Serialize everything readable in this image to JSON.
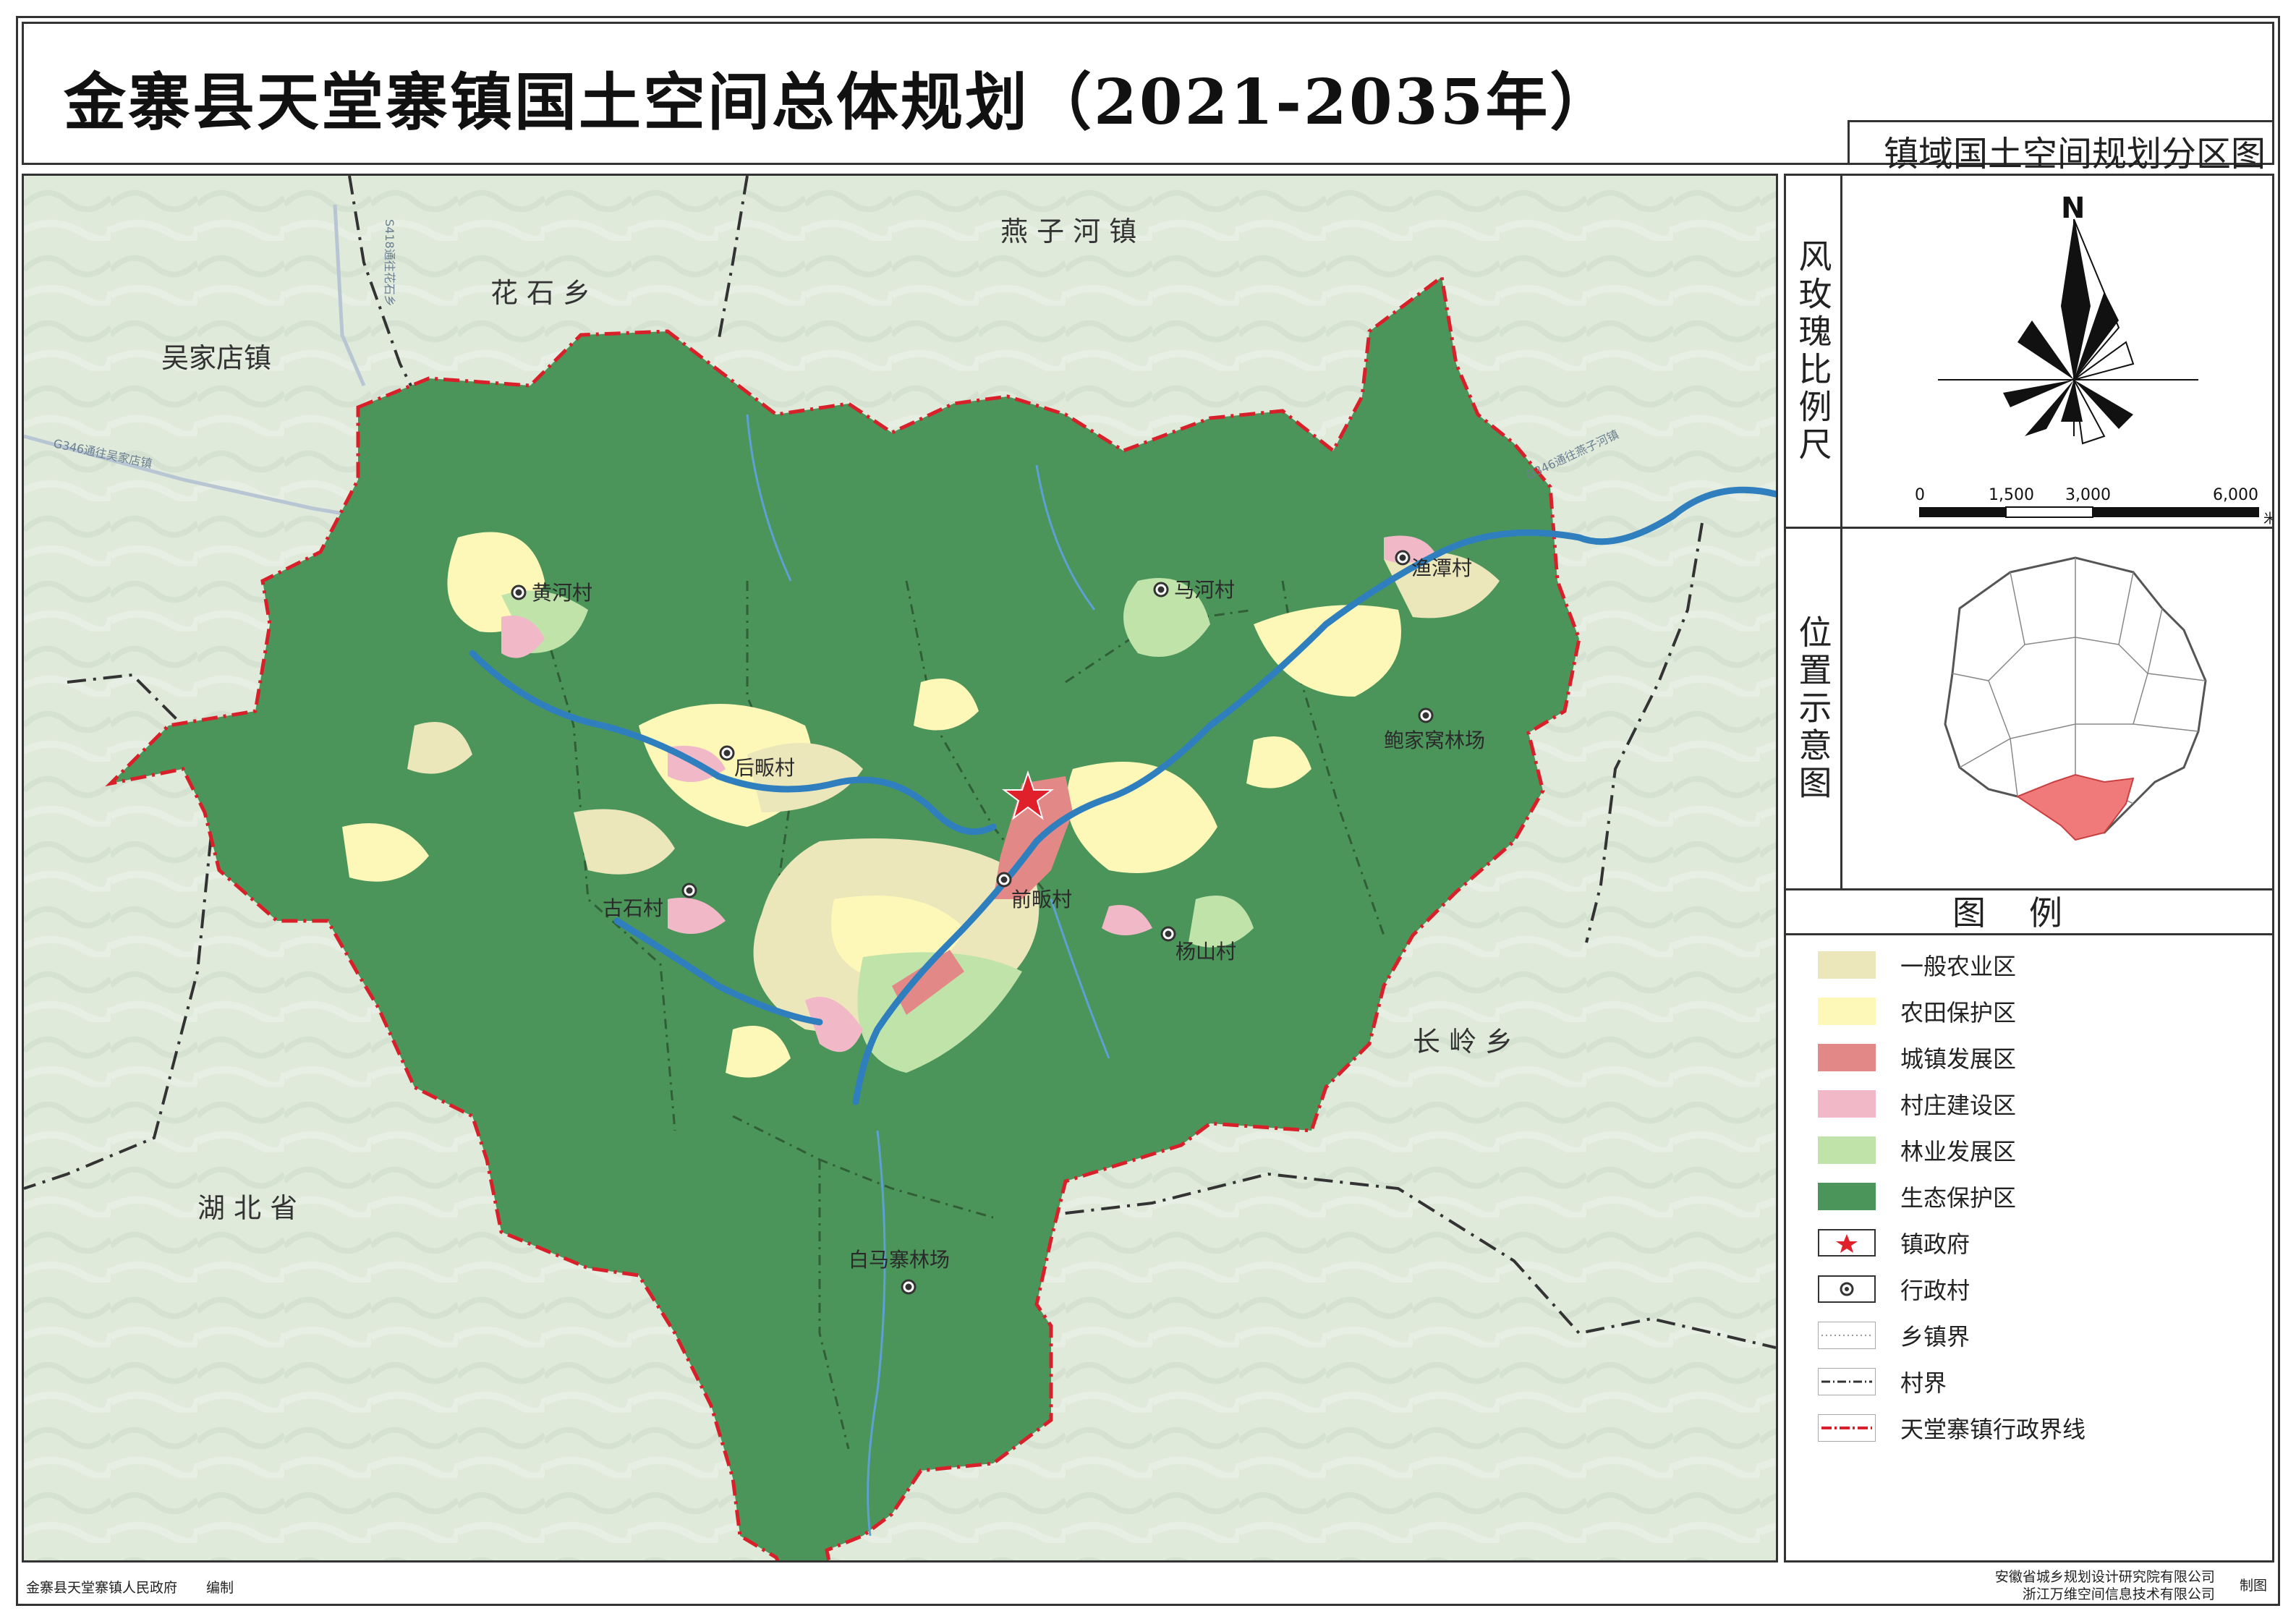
{
  "title": "金寨县天堂寨镇国土空间总体规划（2021-2035年）",
  "subtitle": "镇域国土空间规划分区图",
  "map": {
    "neighbor_labels": [
      {
        "id": "yanzihe",
        "text": "燕 子 河 镇"
      },
      {
        "id": "huashi",
        "text": "花 石 乡"
      },
      {
        "id": "wujiadian",
        "text": "吴家店镇"
      },
      {
        "id": "changling",
        "text": "长 岭 乡"
      },
      {
        "id": "hubei",
        "text": "湖 北 省"
      }
    ],
    "road_labels": [
      {
        "id": "road1",
        "text": "S418通往花石乡"
      },
      {
        "id": "road2",
        "text": "G346通往吴家店镇"
      },
      {
        "id": "road3",
        "text": "G346通往燕子河镇"
      }
    ],
    "villages": [
      {
        "id": "huanghe",
        "text": "黄河村"
      },
      {
        "id": "houpan",
        "text": "后畈村"
      },
      {
        "id": "gushi",
        "text": "古石村"
      },
      {
        "id": "qianpan",
        "text": "前畈村"
      },
      {
        "id": "yangshan",
        "text": "杨山村"
      },
      {
        "id": "mahe",
        "text": "马河村"
      },
      {
        "id": "hutan",
        "text": "渔潭村"
      },
      {
        "id": "baojiawo",
        "text": "鲍家窝林场"
      },
      {
        "id": "baimazhai",
        "text": "白马寨林场"
      }
    ]
  },
  "compass": {
    "label": "风玫瑰比例尺",
    "north": "N",
    "scale_ticks": [
      "0",
      "1,500",
      "3,000",
      "6,000"
    ],
    "scale_unit": "米"
  },
  "locator": {
    "label": "位置示意图"
  },
  "legend": {
    "title": "图例",
    "items": [
      {
        "label": "一般农业区",
        "color": "#ece7bb",
        "kind": "fill"
      },
      {
        "label": "农田保护区",
        "color": "#fdf7b8",
        "kind": "fill"
      },
      {
        "label": "城镇发展区",
        "color": "#e28887",
        "kind": "fill"
      },
      {
        "label": "村庄建设区",
        "color": "#f1b8c8",
        "kind": "fill"
      },
      {
        "label": "林业发展区",
        "color": "#c0e3aa",
        "kind": "fill"
      },
      {
        "label": "生态保护区",
        "color": "#4c955a",
        "kind": "fill"
      },
      {
        "label": "镇政府",
        "color": "#e0202a",
        "kind": "star"
      },
      {
        "label": "行政村",
        "color": "#444444",
        "kind": "village"
      },
      {
        "label": "乡镇界",
        "color": "#bbbbbb",
        "kind": "dotline"
      },
      {
        "label": "村界",
        "color": "#333333",
        "kind": "dashdot"
      },
      {
        "label": "天堂寨镇行政界线",
        "color": "#d8202a",
        "kind": "redline"
      }
    ]
  },
  "footer": {
    "compiler": "金寨县天堂寨镇人民政府",
    "compiled": "编制",
    "maker1": "安徽省城乡规划设计研究院有限公司",
    "maker2": "浙江万维空间信息技术有限公司",
    "made": "制图"
  }
}
